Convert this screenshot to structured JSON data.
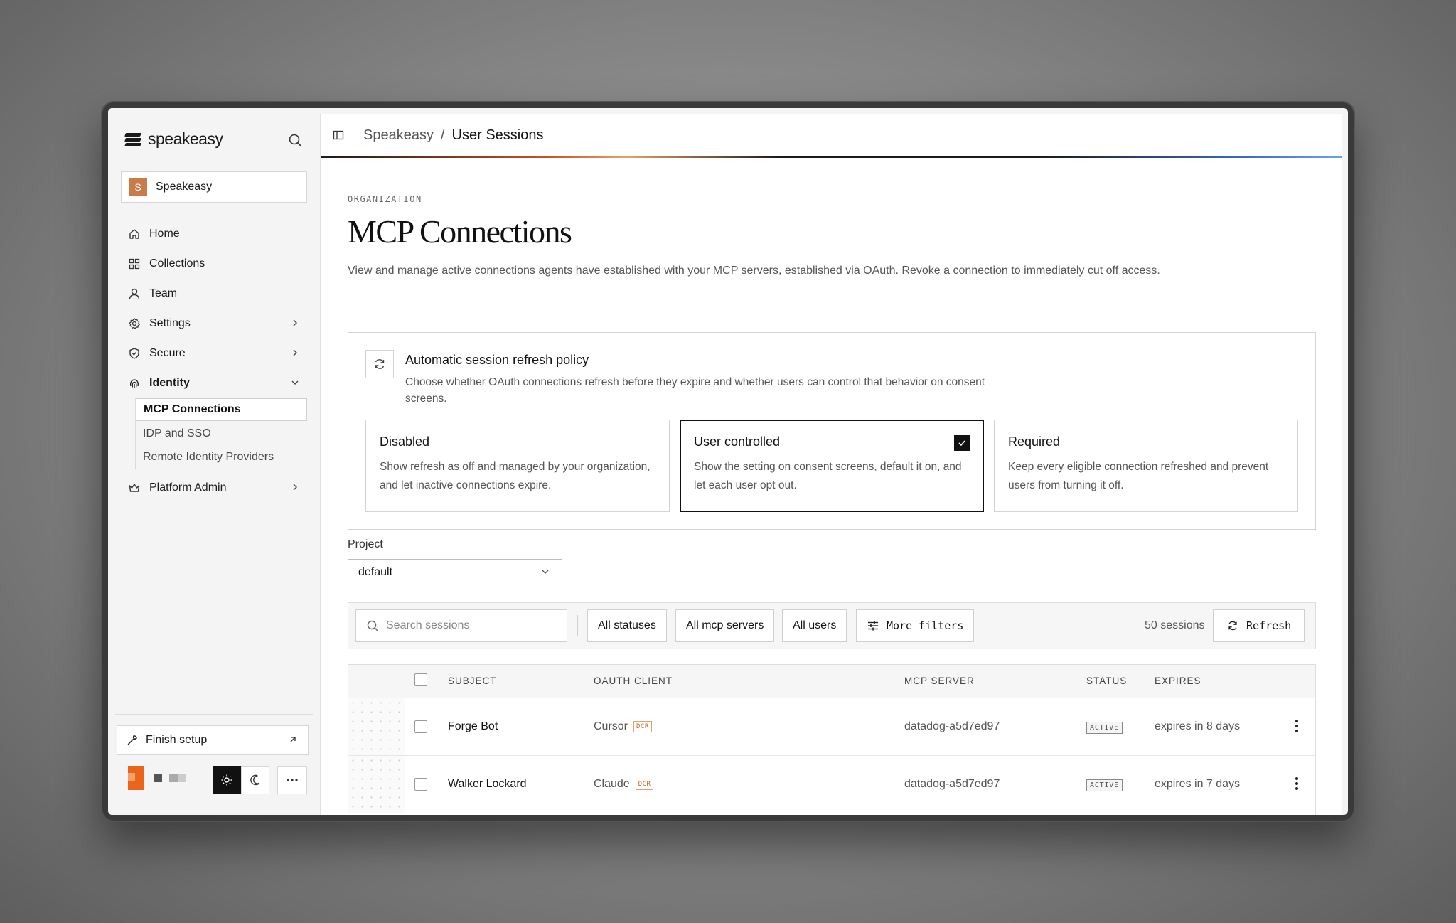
{
  "sidebar": {
    "logo_text": "speakeasy",
    "org": {
      "initial": "S",
      "name": "Speakeasy"
    },
    "nav": [
      {
        "label": "Home",
        "icon": "home-icon"
      },
      {
        "label": "Collections",
        "icon": "grid-icon"
      },
      {
        "label": "Team",
        "icon": "user-icon"
      },
      {
        "label": "Settings",
        "icon": "gear-icon",
        "chevron": "right"
      },
      {
        "label": "Secure",
        "icon": "shield-icon",
        "chevron": "right"
      },
      {
        "label": "Identity",
        "icon": "fingerprint-icon",
        "chevron": "down",
        "expanded": true
      },
      {
        "label": "Platform Admin",
        "icon": "crown-icon",
        "chevron": "right"
      }
    ],
    "identity_sub": [
      {
        "label": "MCP Connections",
        "active": true
      },
      {
        "label": "IDP and SSO"
      },
      {
        "label": "Remote Identity Providers"
      }
    ],
    "finish_setup": "Finish setup",
    "theme_mode": "light"
  },
  "breadcrumb": {
    "root": "Speakeasy",
    "separator": "/",
    "current": "User Sessions"
  },
  "page": {
    "eyebrow": "ORGANIZATION",
    "title": "MCP Connections",
    "description": "View and manage active connections agents have established with your MCP servers, established via OAuth. Revoke a connection to immediately cut off access."
  },
  "policy": {
    "title": "Automatic session refresh policy",
    "description": "Choose whether OAuth connections refresh before they expire and whether users can control that behavior on consent screens.",
    "options": [
      {
        "title": "Disabled",
        "description": "Show refresh as off and managed by your organization, and let inactive connections expire.",
        "selected": false
      },
      {
        "title": "User controlled",
        "description": "Show the setting on consent screens, default it on, and let each user opt out.",
        "selected": true
      },
      {
        "title": "Required",
        "description": "Keep every eligible connection refreshed and prevent users from turning it off.",
        "selected": false
      }
    ]
  },
  "project": {
    "label": "Project",
    "value": "default"
  },
  "filters": {
    "search_placeholder": "Search sessions",
    "status": "All statuses",
    "servers": "All mcp servers",
    "users": "All users",
    "more": "More filters",
    "count": "50 sessions",
    "refresh": "Refresh"
  },
  "table": {
    "headers": {
      "subject": "SUBJECT",
      "client": "OAUTH CLIENT",
      "server": "MCP SERVER",
      "status": "STATUS",
      "expires": "EXPIRES"
    },
    "rows": [
      {
        "subject": "Forge Bot",
        "client": "Cursor",
        "client_tag": "DCR",
        "server": "datadog-a5d7ed97",
        "status": "ACTIVE",
        "expires": "expires in 8 days"
      },
      {
        "subject": "Walker Lockard",
        "client": "Claude",
        "client_tag": "DCR",
        "server": "datadog-a5d7ed97",
        "status": "ACTIVE",
        "expires": "expires in 7 days"
      }
    ]
  },
  "colors": {
    "accent": "#e8651b",
    "org_avatar": "#c97b48",
    "selected_border": "#111111"
  }
}
